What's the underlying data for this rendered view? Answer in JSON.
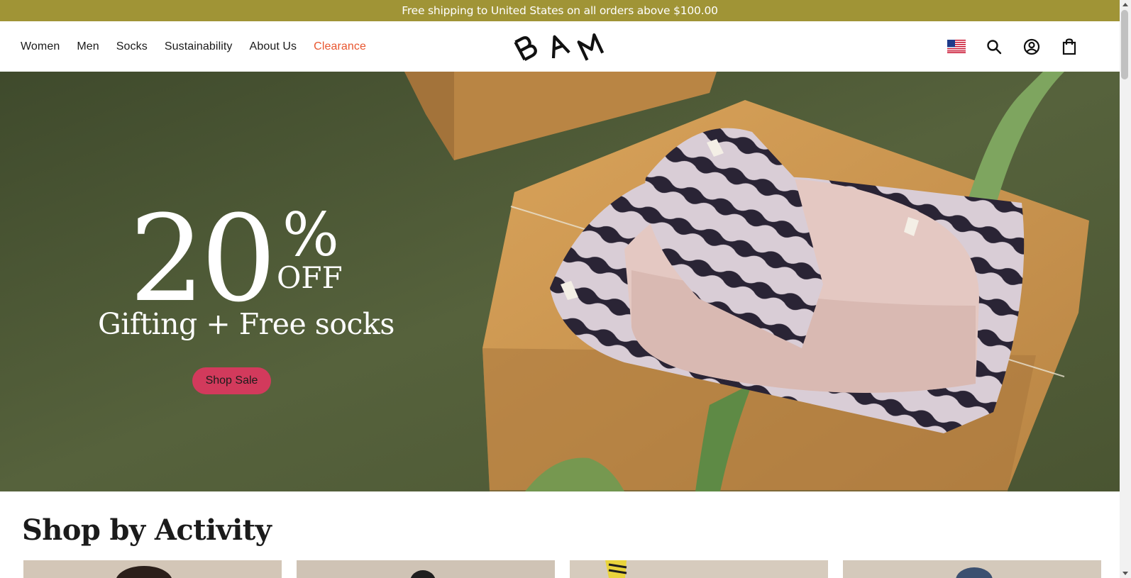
{
  "announcement": {
    "text": "Free shipping to United States on all orders above $100.00"
  },
  "nav": {
    "items": [
      {
        "label": "Women"
      },
      {
        "label": "Men"
      },
      {
        "label": "Socks"
      },
      {
        "label": "Sustainability"
      },
      {
        "label": "About Us"
      },
      {
        "label": "Clearance"
      }
    ]
  },
  "logo": {
    "text": "BAM"
  },
  "header_icons": {
    "flag": "us-flag-icon",
    "search": "search-icon",
    "account": "account-icon",
    "cart": "shopping-bag-icon"
  },
  "hero": {
    "discount_number": "20",
    "discount_percent": "%",
    "discount_off": "OFF",
    "subtitle": "Gifting + Free socks",
    "cta_label": "Shop Sale"
  },
  "section": {
    "title": "Shop by Activity"
  },
  "colors": {
    "announcement_bg": "#a09436",
    "clearance": "#e8562f",
    "cta_bg": "#d23a5c",
    "hero_bg": "#4c5935"
  }
}
